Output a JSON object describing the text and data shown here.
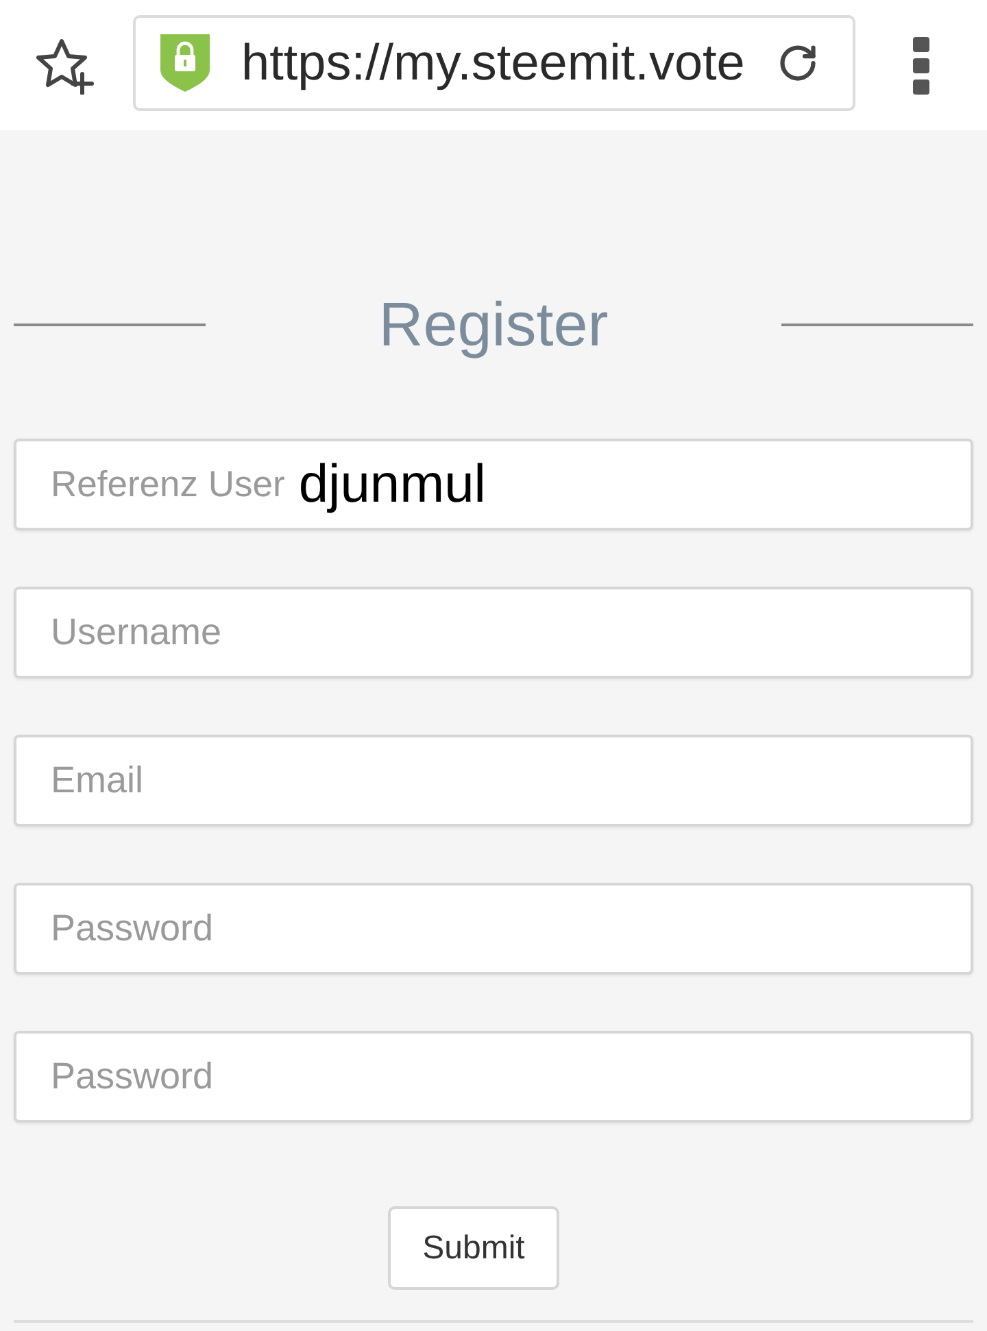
{
  "browser_bar": {
    "url": "https://my.steemit.vote"
  },
  "form": {
    "title": "Register",
    "fields": [
      {
        "kind": "labeled",
        "label": "Referenz User",
        "value": "djunmul"
      },
      {
        "kind": "text",
        "placeholder": "Username"
      },
      {
        "kind": "text",
        "placeholder": "Email"
      },
      {
        "kind": "password",
        "placeholder": "Password"
      },
      {
        "kind": "password",
        "placeholder": "Password"
      }
    ],
    "submit_button": "Submit"
  }
}
